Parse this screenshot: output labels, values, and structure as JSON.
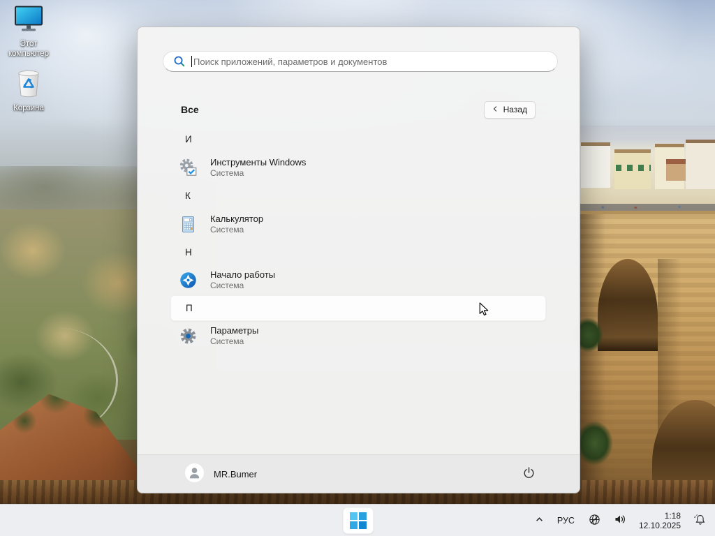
{
  "desktop": {
    "icons": [
      {
        "label": "Этот компьютер",
        "icon": "this-pc-icon"
      },
      {
        "label": "Корзина",
        "icon": "recycle-bin-icon"
      }
    ]
  },
  "start_menu": {
    "search_placeholder": "Поиск приложений, параметров и документов",
    "all_apps_title": "Все",
    "back_button": "Назад",
    "sections": [
      {
        "letter": "И",
        "app": {
          "name": "Инструменты Windows",
          "category": "Система",
          "icon": "windows-tools-icon"
        }
      },
      {
        "letter": "К",
        "app": {
          "name": "Калькулятор",
          "category": "Система",
          "icon": "calculator-icon"
        }
      },
      {
        "letter": "Н",
        "app": {
          "name": "Начало работы",
          "category": "Система",
          "icon": "get-started-icon"
        }
      },
      {
        "letter": "П",
        "highlighted": true,
        "app": {
          "name": "Параметры",
          "category": "Система",
          "icon": "settings-icon"
        }
      }
    ],
    "user_name": "MR.Bumer"
  },
  "taskbar": {
    "language": "РУС",
    "clock": {
      "time": "1:18",
      "date": "12.10.2025"
    },
    "tray_icons": [
      "chevron-up-icon",
      "globe-offline-icon",
      "speaker-icon",
      "notification-bell-dnd-icon"
    ]
  },
  "colors": {
    "accent_blue": "#1189d2",
    "panel_bg": "#f3f3f3",
    "footer_bg": "#e9e9e9",
    "taskbar_bg": "#edeef1",
    "highlight_row": "#fdfdfd"
  }
}
